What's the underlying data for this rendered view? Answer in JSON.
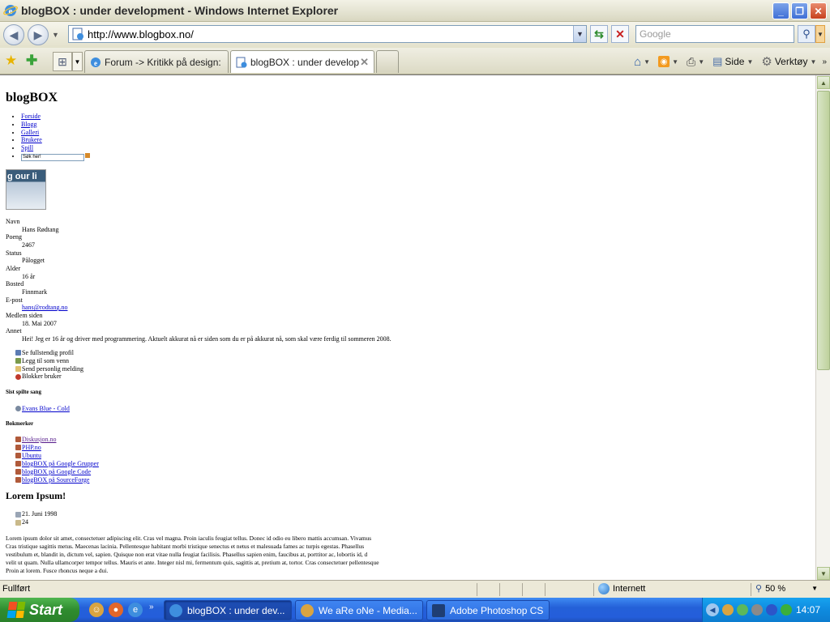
{
  "window": {
    "title": "blogBOX : under development - Windows Internet Explorer"
  },
  "navbar": {
    "url": "http://www.blogbox.no/",
    "search_placeholder": "Google"
  },
  "tabs": [
    {
      "label": "Forum -> Kritikk på design: bl...",
      "active": false
    },
    {
      "label": "blogBOX : under develop...",
      "active": true
    }
  ],
  "commandbar": {
    "page_label": "Side",
    "tools_label": "Verktøy"
  },
  "page": {
    "site_title": "blogBOX",
    "menu": [
      {
        "label": "Forside"
      },
      {
        "label": "Blogg"
      },
      {
        "label": "Galleri"
      },
      {
        "label": "Brukere"
      },
      {
        "label": "Spill"
      }
    ],
    "search_value": "Søk her!",
    "avatar_text": "g our li",
    "profile": [
      {
        "term": "Navn",
        "value": "Hans Rødtang"
      },
      {
        "term": "Poeng",
        "value": "2467"
      },
      {
        "term": "Status",
        "value": "Pålogget"
      },
      {
        "term": "Alder",
        "value": "16 år"
      },
      {
        "term": "Bosted",
        "value": "Finnmark"
      },
      {
        "term": "E-post",
        "value": "hans@rodtang.no",
        "link": true
      },
      {
        "term": "Medlem siden",
        "value": "18. Mai 2007"
      },
      {
        "term": "Annet",
        "value": "Hei! Jeg er 16 år og driver med programmering. Aktuelt akkurat nå er siden som du er på akkurat nå, som skal være ferdig til sommeren 2008."
      }
    ],
    "actions": [
      {
        "label": "Se fullstendig profil",
        "icon": "profile-icon",
        "color": "#5B7BB3"
      },
      {
        "label": "Legg til som venn",
        "icon": "add-friend-icon",
        "color": "#7A9A4B"
      },
      {
        "label": "Send personlig melding",
        "icon": "message-icon",
        "color": "#E0C070"
      },
      {
        "label": "Blokker bruker",
        "icon": "block-icon",
        "color": "#C0392B"
      }
    ],
    "last_played_heading": "Sist spilte sang",
    "last_played": "Evans Blue - Cold",
    "bookmarks_heading": "Bokmerker",
    "bookmarks": [
      {
        "label": "Diskusjon.no",
        "visited": true
      },
      {
        "label": "PHP.no",
        "visited": false
      },
      {
        "label": "Ubuntu",
        "visited": false
      },
      {
        "label": "blogBOX på Google Grupper",
        "visited": false
      },
      {
        "label": "blogBOX på Google Code",
        "visited": false
      },
      {
        "label": "blogBOX på SourceForge",
        "visited": false
      }
    ],
    "post": {
      "title": "Lorem Ipsum!",
      "date": "21. Juni 1998",
      "comments": "24",
      "body": [
        "Lorem ipsum dolor sit amet, consectetuer adipiscing elit. Cras vel magna. Proin iaculis feugiat tellus. Donec id odio eu libero mattis accumsan. Vivamus",
        "Cras tristique sagittis metus. Maecenas lacinia. Pellentesque habitant morbi tristique senectus et netus et malesuada fames ac turpis egestas. Phasellus",
        "vestibulum et, blandit in, dictum vel, sapien. Quisque non erat vitae nulla feugiat facilisis. Phasellus sapien enim, faucibus at, porttitor ac, lobortis id, d",
        "velit ut quam. Nulla ullamcorper tempor tellus. Mauris et ante. Integer nisl mi, fermentum quis, sagittis at, pretium at, tortor. Cras consectetuer pellentesque",
        "Proin at lorem. Fusce rhoncus neque a dui."
      ]
    }
  },
  "statusbar": {
    "status": "Fullført",
    "zone": "Internett",
    "zoom": "50 %"
  },
  "taskbar": {
    "start_label": "Start",
    "tasks": [
      {
        "label": "blogBOX : under dev...",
        "active": true
      },
      {
        "label": "We aRe oNe - Media...",
        "active": false
      },
      {
        "label": "Adobe Photoshop CS...",
        "active": false
      }
    ],
    "clock": "14:07"
  }
}
